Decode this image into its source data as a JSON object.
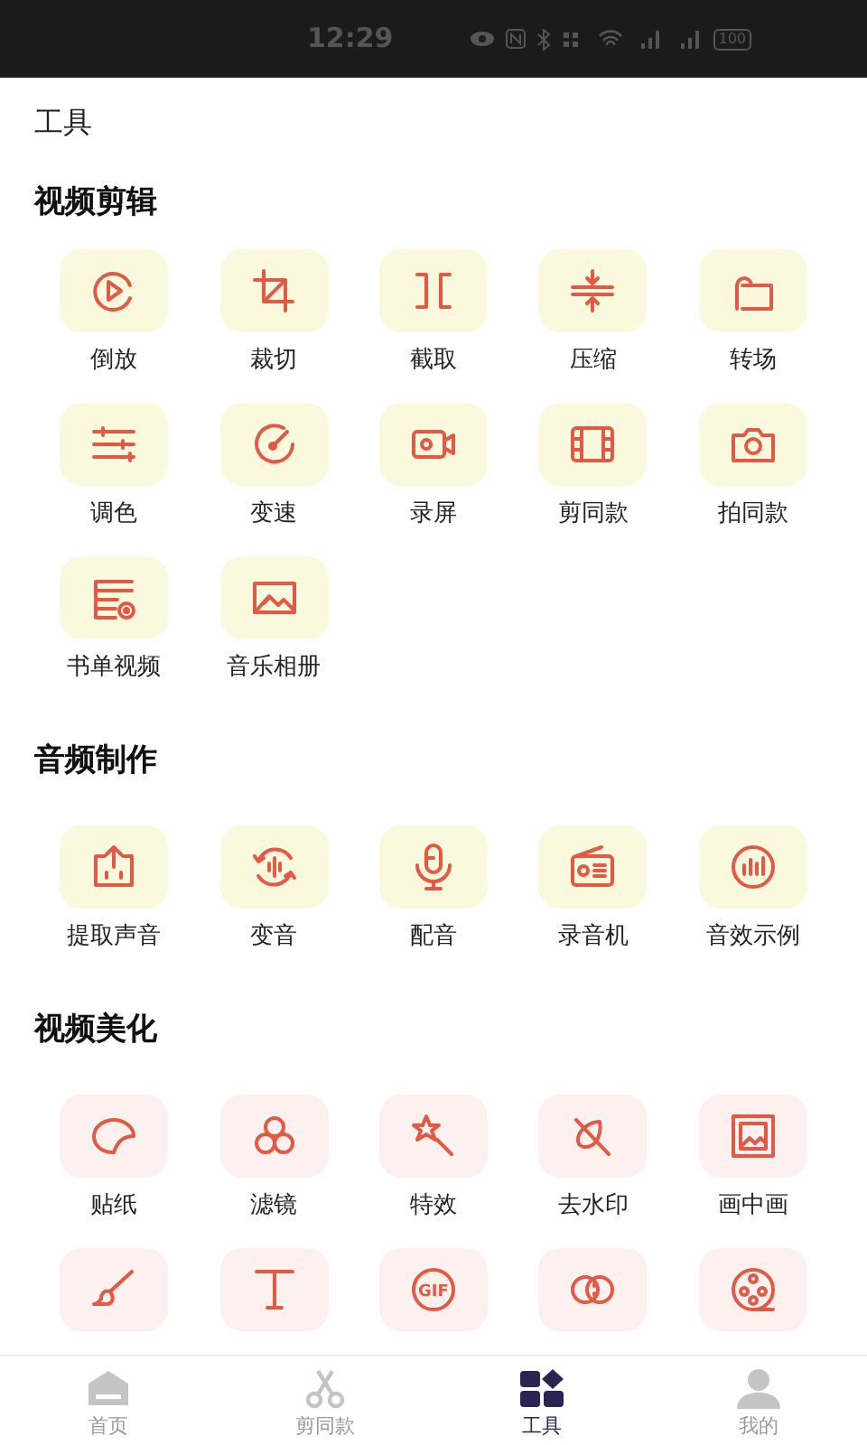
{
  "status_bar": {
    "time": "12:29",
    "battery": "100"
  },
  "page_title": "工具",
  "sections": [
    {
      "title": "视频剪辑",
      "color": "#fbf9dd",
      "items": [
        {
          "kind": "tool",
          "label": "倒放"
        },
        {
          "kind": "tool",
          "label": "裁切"
        },
        {
          "kind": "tool",
          "label": "截取"
        },
        {
          "kind": "tool",
          "label": "压缩"
        },
        {
          "kind": "tool",
          "label": "转场"
        },
        {
          "kind": "tool",
          "label": "调色"
        },
        {
          "kind": "tool",
          "label": "变速"
        },
        {
          "kind": "tool",
          "label": "录屏"
        },
        {
          "kind": "tool",
          "label": "剪同款"
        },
        {
          "kind": "tool",
          "label": "拍同款"
        },
        {
          "kind": "tool",
          "label": "书单视频"
        },
        {
          "kind": "tool",
          "label": "音乐相册"
        }
      ]
    },
    {
      "title": "音频制作",
      "color": "#fbf9dd",
      "items": [
        {
          "kind": "tool",
          "label": "提取声音"
        },
        {
          "kind": "tool",
          "label": "变音"
        },
        {
          "kind": "tool",
          "label": "配音"
        },
        {
          "kind": "tool",
          "label": "录音机"
        },
        {
          "kind": "tool",
          "label": "音效示例"
        }
      ]
    },
    {
      "title": "视频美化",
      "color": "#fdf1ef",
      "items": [
        {
          "kind": "tool",
          "label": "贴纸"
        },
        {
          "kind": "tool",
          "label": "滤镜"
        },
        {
          "kind": "tool",
          "label": "特效"
        },
        {
          "kind": "tool",
          "label": "去水印"
        },
        {
          "kind": "tool",
          "label": "画中画"
        },
        {
          "kind": "tool"
        },
        {
          "kind": "tool"
        },
        {
          "kind": "tool",
          "icon_text": "GIF"
        },
        {
          "kind": "tool"
        },
        {
          "kind": "tool"
        }
      ]
    }
  ],
  "nav": [
    {
      "label": "首页",
      "selected": false
    },
    {
      "label": "剪同款",
      "selected": false
    },
    {
      "label": "工具",
      "selected": true
    },
    {
      "label": "我的",
      "selected": false
    }
  ]
}
